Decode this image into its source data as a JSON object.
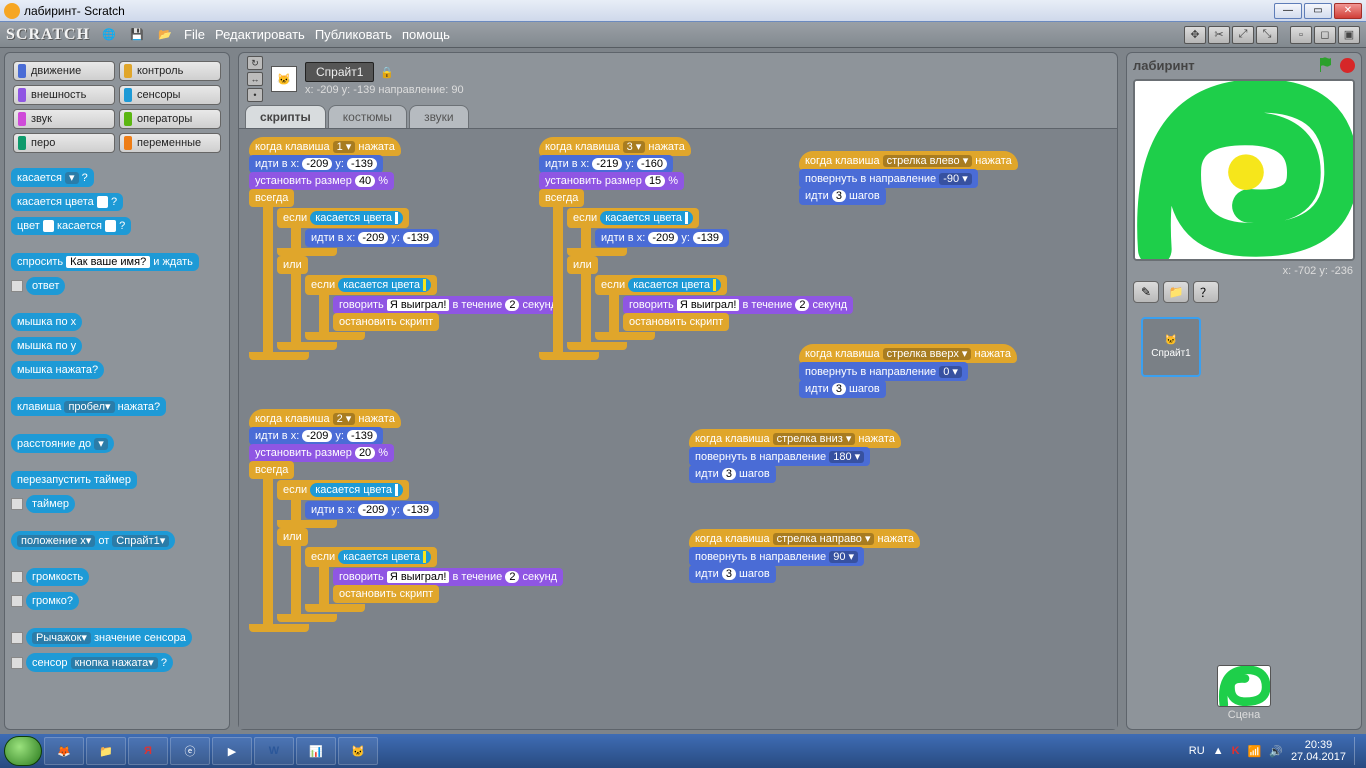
{
  "window": {
    "title": "лабиринт- Scratch"
  },
  "toolbar": {
    "logo": "SCRATCH",
    "menus": [
      "File",
      "Редактировать",
      "Публиковать",
      "помощь"
    ]
  },
  "categories": [
    {
      "label": "движение",
      "color": "#4a6cd6"
    },
    {
      "label": "контроль",
      "color": "#e0a62b"
    },
    {
      "label": "внешность",
      "color": "#8f56e3"
    },
    {
      "label": "сенсоры",
      "color": "#1e9ad6"
    },
    {
      "label": "звук",
      "color": "#cf4ad9"
    },
    {
      "label": "операторы",
      "color": "#5cb712"
    },
    {
      "label": "перо",
      "color": "#0e9a6c"
    },
    {
      "label": "переменные",
      "color": "#ee7d16"
    }
  ],
  "palette": {
    "touching": {
      "label": "касается",
      "arg": "?"
    },
    "touchingColor": {
      "label": "касается цвета",
      "arg": "?"
    },
    "colorTouching": {
      "pre": "цвет",
      "mid": "касается",
      "arg": "?"
    },
    "ask": {
      "label": "спросить",
      "default": "Как ваше имя?",
      "suffix": "и ждать"
    },
    "answer": "ответ",
    "mouseX": "мышка по x",
    "mouseY": "мышка по y",
    "mouseDown": "мышка нажата?",
    "keyPressed": {
      "pre": "клавиша",
      "key": "пробел",
      "post": "нажата?"
    },
    "distanceTo": {
      "label": "расстояние до",
      "arg": ""
    },
    "resetTimer": "перезапустить таймер",
    "timer": "таймер",
    "positionOf": {
      "attr": "положение x",
      "of": "от",
      "target": "Спрайт1"
    },
    "loudness": "громкость",
    "loud": "громко?",
    "sensorValue": {
      "sensor": "Рычажок",
      "label": "значение сенсора"
    },
    "sensorPressed": {
      "pre": "сенсор",
      "sensor": "кнопка нажата",
      "post": "?"
    }
  },
  "sprite": {
    "name": "Спрайт1",
    "info": "x: -209 y: -139 направление: 90"
  },
  "tabs": {
    "scripts": "скрипты",
    "costumes": "костюмы",
    "sounds": "звуки"
  },
  "scripts": {
    "common": {
      "whenKey_pre": "когда клавиша",
      "whenKey_post": "нажата",
      "gotoXY_pre": "идти в x:",
      "gotoXY_mid": "y:",
      "setSize_pre": "установить размер",
      "setSize_post": "%",
      "forever": "всегда",
      "if": "если",
      "or": "или",
      "touchingColor": "касается цвета",
      "say_pre": "говорить",
      "say_mid": "в течение",
      "say_post": "секунд",
      "say_msg": "Я выиграл!",
      "say_secs": "2",
      "stopScript": "остановить скрипт",
      "pointDir": "повернуть в направление",
      "move_pre": "идти",
      "move_post": "шагов",
      "steps": "3"
    },
    "s1": {
      "key": "1",
      "x": "-209",
      "y": "-139",
      "size": "40"
    },
    "s2": {
      "key": "2",
      "x": "-209",
      "y": "-139",
      "size": "20"
    },
    "s3": {
      "key": "3",
      "x": "-219",
      "y": "-160",
      "size": "15",
      "gx": "-209",
      "gy": "-139"
    },
    "left": {
      "key": "стрелка влево",
      "dir": "-90"
    },
    "up": {
      "key": "стрелка вверх",
      "dir": "0"
    },
    "down": {
      "key": "стрелка вниз",
      "dir": "180"
    },
    "right": {
      "key": "стрелка направо",
      "dir": "90"
    }
  },
  "right": {
    "project": "лабиринт",
    "coords": "x: -702   y: -236",
    "spriteThumb": "Спрайт1",
    "scene": "Сцена"
  },
  "taskbar": {
    "lang": "RU",
    "time": "20:39",
    "date": "27.04.2017"
  }
}
